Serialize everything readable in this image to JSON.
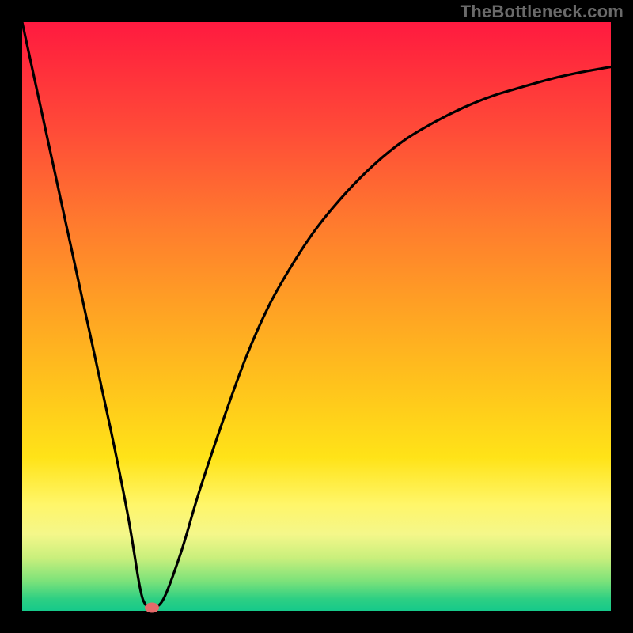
{
  "watermark": "TheBottleneck.com",
  "colors": {
    "frame": "#000000",
    "curve": "#000000",
    "marker": "#e46a6a",
    "gradient_top": "#ff1a40",
    "gradient_bottom": "#16c98a"
  },
  "chart_data": {
    "type": "line",
    "title": "",
    "xlabel": "",
    "ylabel": "",
    "xlim": [
      0,
      100
    ],
    "ylim": [
      0,
      100
    ],
    "grid": false,
    "legend": false,
    "series": [
      {
        "name": "bottleneck-curve",
        "x": [
          0,
          5,
          10,
          15,
          18,
          20,
          21,
          22,
          24,
          27,
          30,
          34,
          38,
          42,
          46,
          50,
          55,
          60,
          65,
          70,
          75,
          80,
          85,
          90,
          95,
          100
        ],
        "y": [
          100,
          77,
          54,
          31,
          16,
          4,
          1,
          0.5,
          2,
          10,
          20,
          32,
          43,
          52,
          59,
          65,
          71,
          76,
          80,
          83,
          85.5,
          87.5,
          89,
          90.4,
          91.5,
          92.4
        ]
      }
    ],
    "marker": {
      "x": 22,
      "y": 0.5,
      "shape": "ellipse",
      "color": "#e46a6a"
    },
    "annotations": [
      {
        "text": "TheBottleneck.com",
        "position": "top-right"
      }
    ]
  }
}
